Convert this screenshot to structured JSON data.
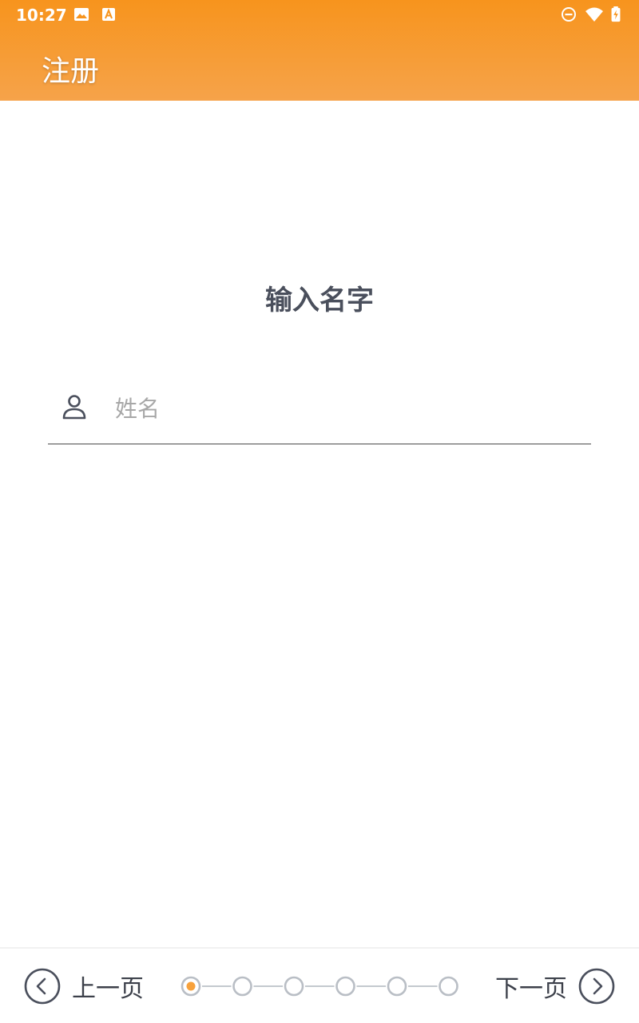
{
  "status_bar": {
    "time": "10:27",
    "left_icons": [
      "image-icon",
      "font-a-icon"
    ],
    "right_icons": [
      "do-not-disturb-icon",
      "wifi-icon",
      "battery-charging-icon"
    ]
  },
  "header": {
    "title": "注册",
    "color_top": "#f7941d",
    "color_bottom": "#f6a34a"
  },
  "main": {
    "heading": "输入名字",
    "name_field": {
      "icon": "person-icon",
      "placeholder": "姓名",
      "value": ""
    }
  },
  "footer": {
    "prev_label": "上一页",
    "next_label": "下一页",
    "step_count": 6,
    "current_step": 1,
    "accent": "#f7a13b"
  }
}
